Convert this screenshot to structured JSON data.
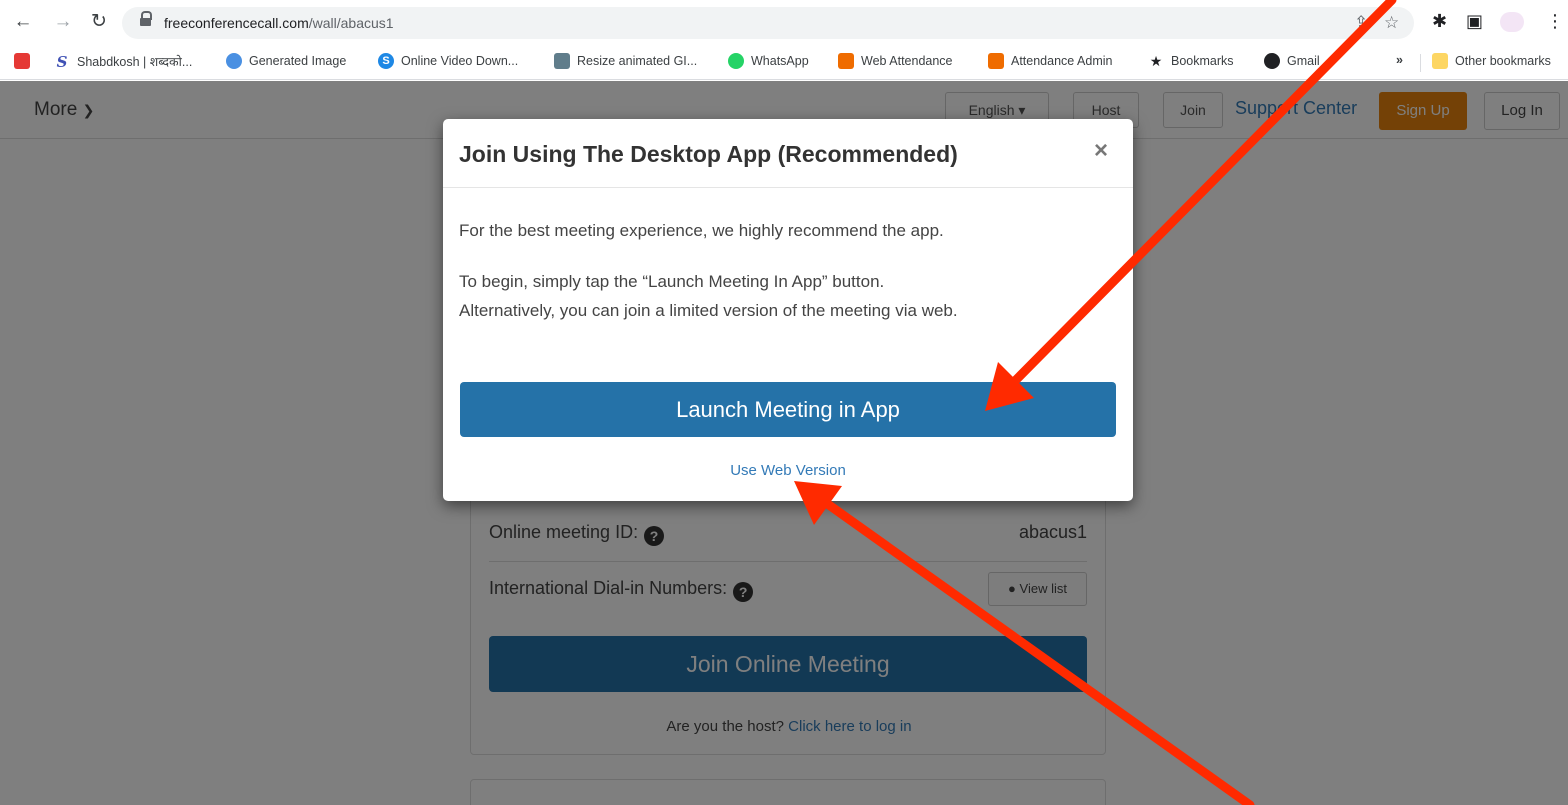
{
  "browser": {
    "url_host": "freeconferencecall.com",
    "url_path": "/wall/abacus1",
    "icons": [
      "back-icon",
      "forward-icon",
      "reload-icon",
      "lock-icon",
      "share-icon",
      "star-icon",
      "extensions-icon",
      "sidepanel-icon",
      "profile-icon",
      "menu-icon"
    ]
  },
  "bookmarks": {
    "items": [
      {
        "label": "Shabdkosh | शब्दको..."
      },
      {
        "label": "Generated Image"
      },
      {
        "label": "Online Video Down..."
      },
      {
        "label": "Resize animated GI..."
      },
      {
        "label": "WhatsApp"
      },
      {
        "label": "Web Attendance"
      },
      {
        "label": "Attendance Admin"
      },
      {
        "label": "Bookmarks"
      },
      {
        "label": "Gmail"
      }
    ],
    "overflow": "»",
    "other": "Other bookmarks"
  },
  "site": {
    "more_label": "More",
    "language": "English",
    "host_label": "Host",
    "join_label": "Join",
    "support_label": "Support Center",
    "signup_label": "Sign Up",
    "login_label": "Log In"
  },
  "panel": {
    "meeting_id_label": "Online meeting ID:",
    "meeting_id_value": "abacus1",
    "dialin_label": "International Dial-in Numbers:",
    "view_list_label": "View list",
    "join_button": "Join Online Meeting",
    "host_prompt": "Are you the host?",
    "host_link": "Click here to log in"
  },
  "modal": {
    "title": "Join Using The Desktop App (Recommended)",
    "close": "×",
    "paragraph1": "For the best meeting experience, we highly recommend the app.",
    "paragraph2_line1": "To begin, simply tap the “Launch Meeting In App” button.",
    "paragraph2_line2": "Alternatively, you can join a limited version of the meeting via web.",
    "launch_button": "Launch Meeting in App",
    "web_link": "Use Web Version"
  },
  "annotations": {
    "arrow_color": "#ff2a00"
  }
}
